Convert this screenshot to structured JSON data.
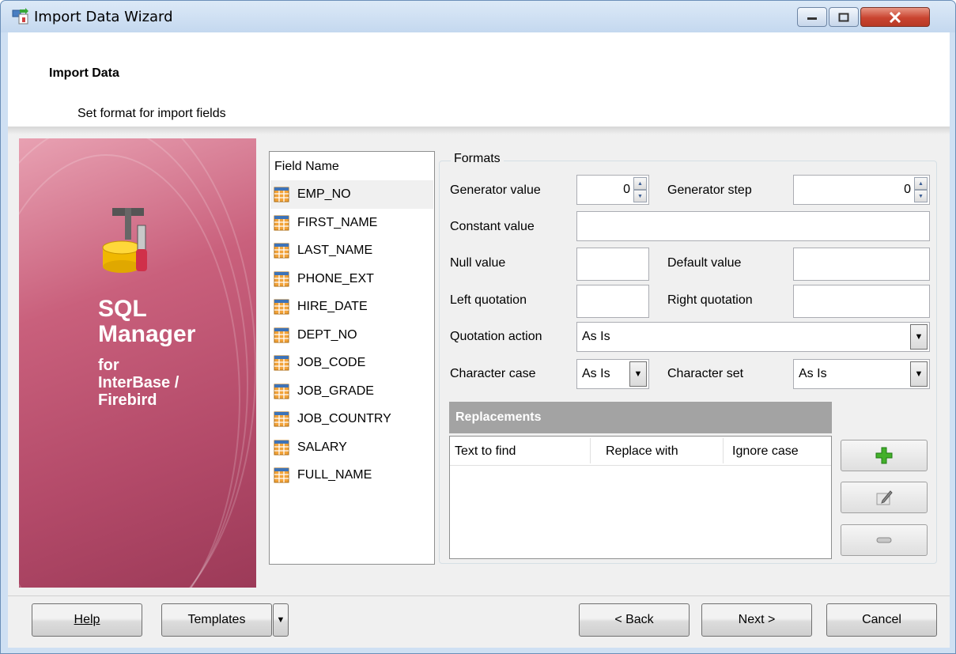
{
  "window": {
    "title": "Import Data Wizard"
  },
  "header": {
    "title": "Import Data",
    "subtitle": "Set format for import fields"
  },
  "side_panel": {
    "product_line1": "SQL",
    "product_line2": "Manager",
    "product_line3": "for",
    "product_line4": "InterBase /",
    "product_line5": "Firebird"
  },
  "fields": {
    "header": "Field Name",
    "items": [
      "EMP_NO",
      "FIRST_NAME",
      "LAST_NAME",
      "PHONE_EXT",
      "HIRE_DATE",
      "DEPT_NO",
      "JOB_CODE",
      "JOB_GRADE",
      "JOB_COUNTRY",
      "SALARY",
      "FULL_NAME"
    ],
    "selected": "EMP_NO"
  },
  "formats": {
    "caption": "Formats",
    "generator_value_label": "Generator value",
    "generator_value": "0",
    "generator_step_label": "Generator step",
    "generator_step": "0",
    "constant_value_label": "Constant value",
    "constant_value": "",
    "null_value_label": "Null value",
    "null_value": "",
    "default_value_label": "Default value",
    "default_value": "",
    "left_quotation_label": "Left quotation",
    "left_quotation": "",
    "right_quotation_label": "Right quotation",
    "right_quotation": "",
    "quotation_action_label": "Quotation action",
    "quotation_action": "As Is",
    "character_case_label": "Character case",
    "character_case": "As Is",
    "character_set_label": "Character set",
    "character_set": "As Is"
  },
  "replacements": {
    "title": "Replacements",
    "columns": [
      "Text to find",
      "Replace with",
      "Ignore case"
    ],
    "rows": []
  },
  "buttons": {
    "help": "Help",
    "templates": "Templates",
    "back": "< Back",
    "next": "Next >",
    "cancel": "Cancel"
  },
  "colors": {
    "side_panel": "#b34a69",
    "replacements_header": "#a3a3a3",
    "close_button": "#c94430"
  }
}
